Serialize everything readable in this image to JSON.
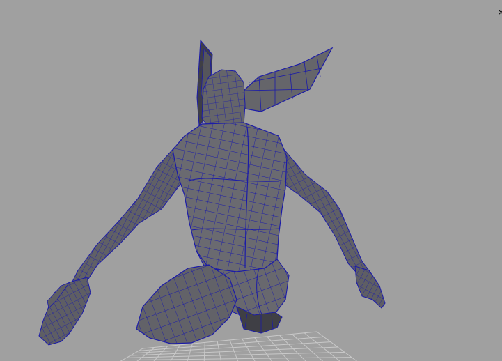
{
  "viewport": {
    "background_color": "#a0a0a0",
    "wire_color": "#1b1ba8",
    "mesh_fill_color": "#65656a",
    "mesh_shadow_color": "#3f3f45",
    "mesh_highlight_color": "#7a7a80",
    "grid_color": "#c9c9c9",
    "corner_glyph": "×"
  }
}
